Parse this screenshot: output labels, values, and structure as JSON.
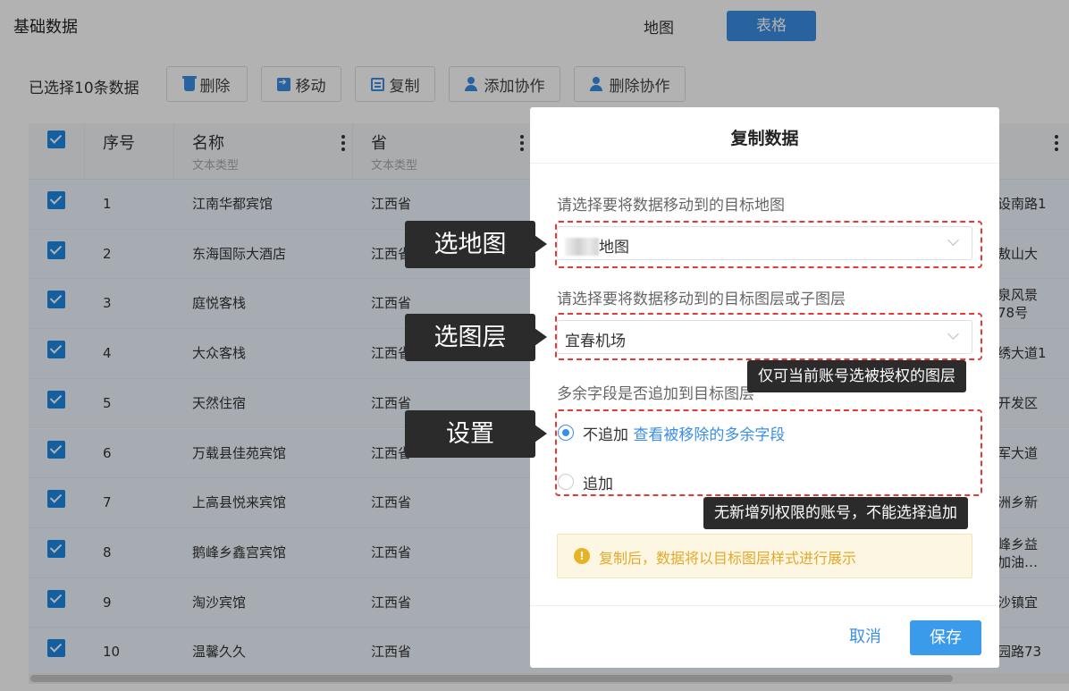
{
  "header": {
    "title": "基础数据",
    "view_map": "地图",
    "view_table": "表格"
  },
  "toolbar": {
    "selected_count": "已选择10条数据",
    "delete_label": "删除",
    "move_label": "移动",
    "copy_label": "复制",
    "add_collab_label": "添加协作",
    "remove_collab_label": "删除协作"
  },
  "table": {
    "columns": [
      {
        "title": "序号",
        "subtitle": ""
      },
      {
        "title": "名称",
        "subtitle": "文本类型"
      },
      {
        "title": "省",
        "subtitle": "文本类型"
      }
    ],
    "rows": [
      {
        "no": "1",
        "name": "江南华都宾馆",
        "province": "江西省",
        "right": [
          "设南路1"
        ]
      },
      {
        "no": "2",
        "name": "东海国际大酒店",
        "province": "江西省",
        "right": [
          "敖山大"
        ]
      },
      {
        "no": "3",
        "name": "庭悦客栈",
        "province": "江西省",
        "right": [
          "泉风景",
          "78号"
        ]
      },
      {
        "no": "4",
        "name": "大众客栈",
        "province": "江西省",
        "right": [
          "绣大道1"
        ]
      },
      {
        "no": "5",
        "name": "天然住宿",
        "province": "江西省",
        "right": [
          "开发区"
        ]
      },
      {
        "no": "6",
        "name": "万载县佳苑宾馆",
        "province": "江西省",
        "right": [
          "军大道"
        ]
      },
      {
        "no": "7",
        "name": "上高县悦来宾馆",
        "province": "江西省",
        "right": [
          "洲乡新"
        ]
      },
      {
        "no": "8",
        "name": "鹅峰乡鑫宫宾馆",
        "province": "江西省",
        "right": [
          "峰乡益",
          "加油…"
        ]
      },
      {
        "no": "9",
        "name": "淘沙宾馆",
        "province": "江西省",
        "right": [
          "沙镇宜"
        ]
      },
      {
        "no": "10",
        "name": "温馨久久",
        "province": "江西省",
        "right": [
          "园路73"
        ]
      }
    ]
  },
  "modal": {
    "title": "复制数据",
    "map_label": "请选择要将数据移动到的目标地图",
    "map_value": "地图",
    "layer_label": "请选择要将数据移动到的目标图层或子图层",
    "layer_value": "宜春机场",
    "extra_label": "多余字段是否追加到目标图层",
    "option_no_append": "不追加",
    "view_removed_link": "查看被移除的多余字段",
    "option_append": "追加",
    "notice_icon": "!",
    "notice": "复制后，数据将以目标图层样式进行展示",
    "cancel_label": "取消",
    "save_label": "保存"
  },
  "annotations": {
    "select_map": "选地图",
    "select_layer": "选图层",
    "settings": "设置",
    "layer_tip": "仅可当前账号选被授权的图层",
    "append_tip": "无新增列权限的账号，不能选择追加"
  },
  "colors": {
    "accent": "#3a8ee6",
    "annotation_box": "#e53935",
    "callout_bg": "#2b2b2b",
    "notice_text": "#e3a92b"
  }
}
